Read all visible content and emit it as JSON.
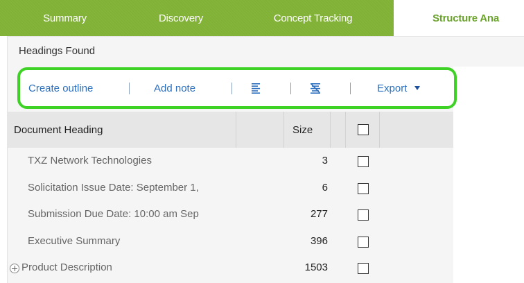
{
  "tabs": [
    {
      "label": "Summary",
      "active": false
    },
    {
      "label": "Discovery",
      "active": false
    },
    {
      "label": "Concept Tracking",
      "active": false
    },
    {
      "label": "Structure Ana",
      "active": true
    }
  ],
  "panel": {
    "title": "Headings Found"
  },
  "toolbar": {
    "create_outline": "Create outline",
    "add_note": "Add note",
    "export": "Export",
    "icons": [
      "align-left-icon",
      "clear-format-icon"
    ]
  },
  "table": {
    "columns": {
      "heading": "Document Heading",
      "size": "Size"
    },
    "rows": [
      {
        "heading": "TXZ Network Technologies",
        "size": "3",
        "expandable": false
      },
      {
        "heading": "Solicitation Issue Date: September 1,",
        "size": "6",
        "expandable": false
      },
      {
        "heading": "Submission Due Date: 10:00 am Sep",
        "size": "277",
        "expandable": false
      },
      {
        "heading": "Executive Summary",
        "size": "396",
        "expandable": false
      },
      {
        "heading": "Product Description",
        "size": "1503",
        "expandable": true
      }
    ]
  },
  "colors": {
    "tab_green": "#81b236",
    "active_tab_text": "#6aa12b",
    "link_blue": "#2a6ebd",
    "highlight_outline": "#3fd226"
  }
}
